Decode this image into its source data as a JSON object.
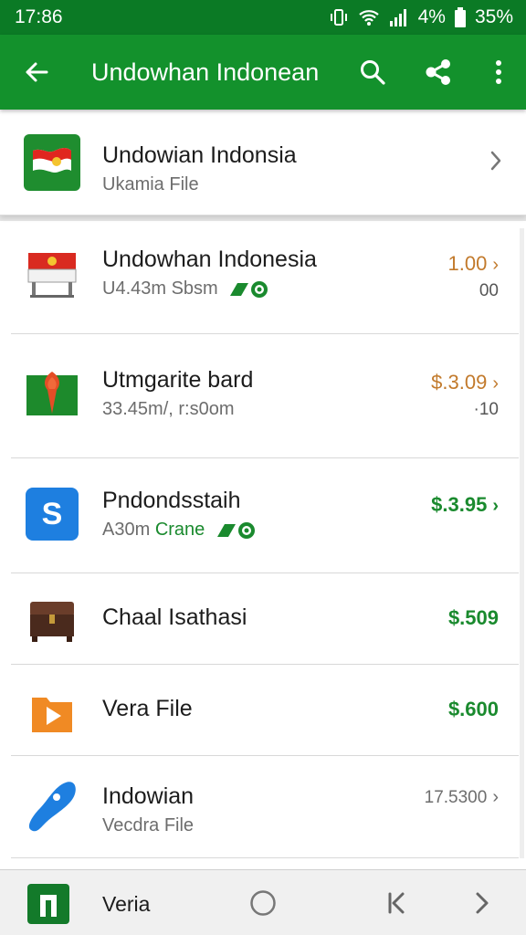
{
  "status_bar": {
    "time": "17:86",
    "battery_text": "4%",
    "extra_text": "35%",
    "icons": [
      "vibrate-icon",
      "wifi-icon",
      "signal-icon",
      "battery-icon"
    ]
  },
  "app_bar": {
    "title": "Undowhan Indonean",
    "color": "#13912c",
    "icons": [
      "back-arrow-icon",
      "search-icon",
      "share-icon",
      "more-vert-icon"
    ]
  },
  "header_item": {
    "title": "Undowian Indonsia",
    "subtitle": "Ukamia File",
    "icon": "flag-icon"
  },
  "items": [
    {
      "title": "Undowhan Indonesia",
      "subtitle": "U4.43m Sbsm",
      "price": "1.00",
      "price_sub": "00",
      "icon": "table-flag-icon"
    },
    {
      "title": "Utmgarite bard",
      "subtitle": "33.45m/, r:s0om",
      "price": "$.3.09",
      "price_sub": "·10",
      "icon": "pin-flag-icon"
    },
    {
      "title": "Pndondsstaih",
      "subtitle": "A30m",
      "subtitle_highlight": "Crane",
      "price": "$.3.95",
      "icon": "s-letter-icon",
      "icon_letter": "S"
    },
    {
      "title": "Chaal Isathasi",
      "price": "$.509",
      "icon": "chest-icon"
    },
    {
      "title": "Vera File",
      "price": "$.600",
      "icon": "play-folder-icon"
    },
    {
      "title": "Indowian",
      "subtitle": "Vecdra File",
      "price": "17.5300",
      "icon": "blue-blob-icon"
    }
  ],
  "bottom_bar": {
    "label": "Veria",
    "icons": [
      "app-icon",
      "home-circle-icon",
      "back-chevron-icon",
      "forward-chevron-icon"
    ]
  }
}
